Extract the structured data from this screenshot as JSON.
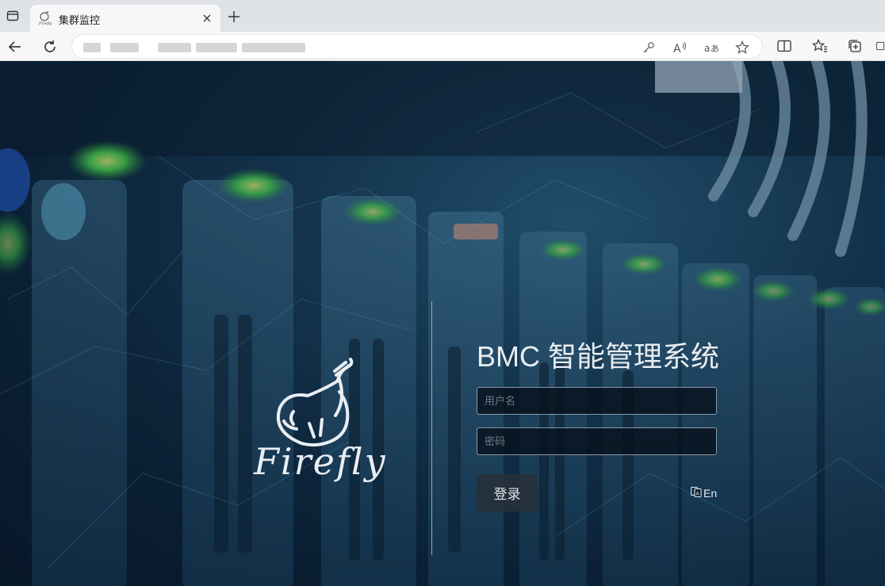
{
  "browser": {
    "tab": {
      "title": "集群监控",
      "favicon_text": "Firefly"
    },
    "icons": {
      "window": "window-icon",
      "close": "close-icon",
      "new_tab": "plus-icon",
      "back": "back-arrow-icon",
      "refresh": "refresh-icon",
      "key": "key-icon",
      "read_aloud": "read-aloud-icon",
      "translate": "translate-icon",
      "favorite": "star-icon",
      "split": "split-screen-icon",
      "favorites": "favorites-icon",
      "collections": "collections-icon"
    }
  },
  "login": {
    "title": "BMC 智能管理系统",
    "username_placeholder": "用户名",
    "password_placeholder": "密码",
    "submit_label": "登录",
    "language_label": "En"
  },
  "brand": {
    "logo_text": "Firefly"
  }
}
